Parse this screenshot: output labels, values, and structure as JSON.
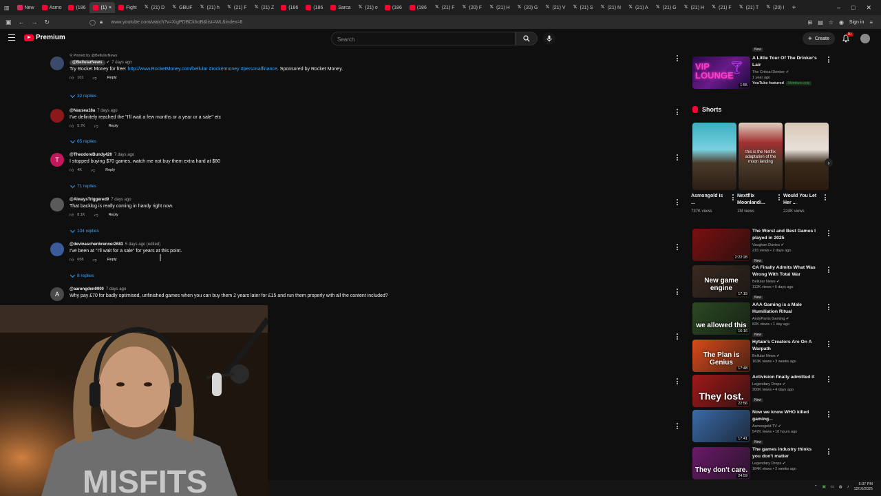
{
  "browser": {
    "tabs": [
      {
        "label": "New",
        "icon": "red"
      },
      {
        "label": "Asmo",
        "icon": "yt"
      },
      {
        "label": "(186",
        "icon": "yt"
      },
      {
        "label": "(1)",
        "icon": "yt",
        "active": true
      },
      {
        "label": "Fight",
        "icon": "yt"
      },
      {
        "label": "(21) D",
        "icon": "x"
      },
      {
        "label": "GBUF",
        "icon": "x"
      },
      {
        "label": "(21) h",
        "icon": "x"
      },
      {
        "label": "(21) F",
        "icon": "x"
      },
      {
        "label": "(21) Z",
        "icon": "x"
      },
      {
        "label": "(186",
        "icon": "yt"
      },
      {
        "label": "(186",
        "icon": "yt"
      },
      {
        "label": "Sarca",
        "icon": "yt"
      },
      {
        "label": "(21) o",
        "icon": "x"
      },
      {
        "label": "(186",
        "icon": "yt"
      },
      {
        "label": "(186",
        "icon": "yt"
      },
      {
        "label": "(21) F",
        "icon": "x"
      },
      {
        "label": "(20) F",
        "icon": "x"
      },
      {
        "label": "(21) H",
        "icon": "x"
      },
      {
        "label": "(20) G",
        "icon": "x"
      },
      {
        "label": "(21) V",
        "icon": "x"
      },
      {
        "label": "(21) S",
        "icon": "x"
      },
      {
        "label": "(21) N",
        "icon": "x"
      },
      {
        "label": "(21) A",
        "icon": "x"
      },
      {
        "label": "(21) G",
        "icon": "x"
      },
      {
        "label": "(21) H",
        "icon": "x"
      },
      {
        "label": "(21) F",
        "icon": "x"
      },
      {
        "label": "(21) T",
        "icon": "x"
      },
      {
        "label": "(20) I",
        "icon": "x"
      }
    ],
    "url": "www.youtube.com/watch?v=XigPDBCkhoB&list=WL&index=6",
    "signin_label": "Sign in"
  },
  "header": {
    "brand": "Premium",
    "search_placeholder": "Search",
    "create_label": "Create",
    "notification_count": "9+"
  },
  "comments": [
    {
      "pinned_label": "Pinned by @BellularNews",
      "handle": "@BellularNews",
      "verified": true,
      "time": "7 days ago",
      "text_prefix": "Try Rocket Money for free: ",
      "link": "http://www.RocketMoney.com/bellular #rocketmoney #personalfinance",
      "text_suffix": ". Sponsored by Rocket Money.",
      "likes": "101",
      "reply_label": "Reply",
      "replies_label": "32 replies",
      "avatar_color": "#3b4a6b",
      "avatar_letter": ""
    },
    {
      "handle": "@Nausea18a",
      "time": "7 days ago",
      "text": "I've definitely reached the \"I'll wait a few months or a year or a sale\" etc",
      "likes": "5.7K",
      "reply_label": "Reply",
      "replies_label": "65 replies",
      "avatar_color": "#8a1a1a",
      "avatar_letter": ""
    },
    {
      "handle": "@TheodoreBundy420",
      "time": "7 days ago",
      "text": "I stopped buying $70 games, watch me not buy them extra hard at $80",
      "likes": "4K",
      "reply_label": "Reply",
      "replies_label": "71 replies",
      "avatar_color": "#c2185b",
      "avatar_letter": "T"
    },
    {
      "handle": "@AlwaysTriggered9",
      "time": "7 days ago",
      "text": "That backlog is really coming in handy right now.",
      "likes": "8.1K",
      "reply_label": "Reply",
      "replies_label": "134 replies",
      "avatar_color": "#5a5a5a",
      "avatar_letter": ""
    },
    {
      "handle": "@devinaschenbrenner2683",
      "time": "5 days ago (edited)",
      "text": "I've been at \"I'll wait for a sale\" for years at this point.",
      "likes": "658",
      "reply_label": "Reply",
      "replies_label": "8 replies",
      "avatar_color": "#3a5a9a",
      "avatar_letter": ""
    },
    {
      "handle": "@aarongden9900",
      "time": "7 days ago",
      "text": "Why pay £70 for badly optimised, unfinished games when you can buy them 2 years later for £15 and run them properly with all the content included?",
      "likes": "",
      "reply_label": "",
      "replies_label": "",
      "avatar_color": "#4a4a4a",
      "avatar_letter": "A"
    }
  ],
  "sidebar": {
    "top_video": {
      "title": "A Little Tour Of The Drinker's Lair",
      "channel": "The Critical Drinker",
      "meta": "1 year ago",
      "featured": "YouTube featured",
      "members": "Members only",
      "duration": "1:55",
      "thumb_text": "VIP LOUNGE",
      "badge": "New"
    },
    "shorts_heading": "Shorts",
    "shorts": [
      {
        "title": "Asmongold Is ...",
        "views": "737K views",
        "overlay": ""
      },
      {
        "title": "Nextflix Moonlandi...",
        "views": "1M views",
        "overlay": "this is the Netflix adaptation of the moon landing"
      },
      {
        "title": "Would You Let Her ...",
        "views": "224K views",
        "overlay": ""
      }
    ],
    "videos": [
      {
        "title": "The Worst and Best Games I played in 2025",
        "channel": "Vaughan Davies",
        "meta": "215 views • 2 days ago",
        "badge": "New",
        "duration": "2:22:28",
        "thumb_text": "",
        "thumb_color": "#7a1010"
      },
      {
        "title": "CA Finally Admits What Was Wrong With Total War",
        "channel": "Bellular News",
        "meta": "112K views • 6 days ago",
        "badge": "New",
        "duration": "17:15",
        "thumb_text": "New game engine",
        "thumb_color": "#3a2a20"
      },
      {
        "title": "AAA Gaming is a Male Humiliation Ritual",
        "channel": "AndyPants Gaming",
        "meta": "82K views • 1 day ago",
        "badge": "New",
        "duration": "16:16",
        "thumb_text": "we allowed this",
        "thumb_color": "#2a4a22"
      },
      {
        "title": "Hytale's Creators Are On A Warpath",
        "channel": "Bellular News",
        "meta": "163K views • 3 weeks ago",
        "badge": "",
        "duration": "17:48",
        "thumb_text": "The Plan is Genius",
        "thumb_color": "#d94a1a"
      },
      {
        "title": "Activision finally admitted it",
        "channel": "Legendary Drops",
        "meta": "300K views • 4 days ago",
        "badge": "New",
        "duration": "22:56",
        "thumb_text": "They lost.",
        "thumb_color": "#a01818"
      },
      {
        "title": "Now we know WHO killed gaming...",
        "channel": "Asmongold TV",
        "meta": "547K views • 10 hours ago",
        "badge": "New",
        "duration": "17:41",
        "thumb_text": "",
        "thumb_color": "#3a6aa8"
      },
      {
        "title": "The games industry thinks you don't matter",
        "channel": "Legendary Drops",
        "meta": "184K views • 2 weeks ago",
        "badge": "",
        "duration": "24:59",
        "thumb_text": "They don't care.",
        "thumb_color": "#6a1a6a"
      }
    ]
  },
  "taskbar": {
    "time": "5:37 PM",
    "date": "12/16/2025"
  }
}
